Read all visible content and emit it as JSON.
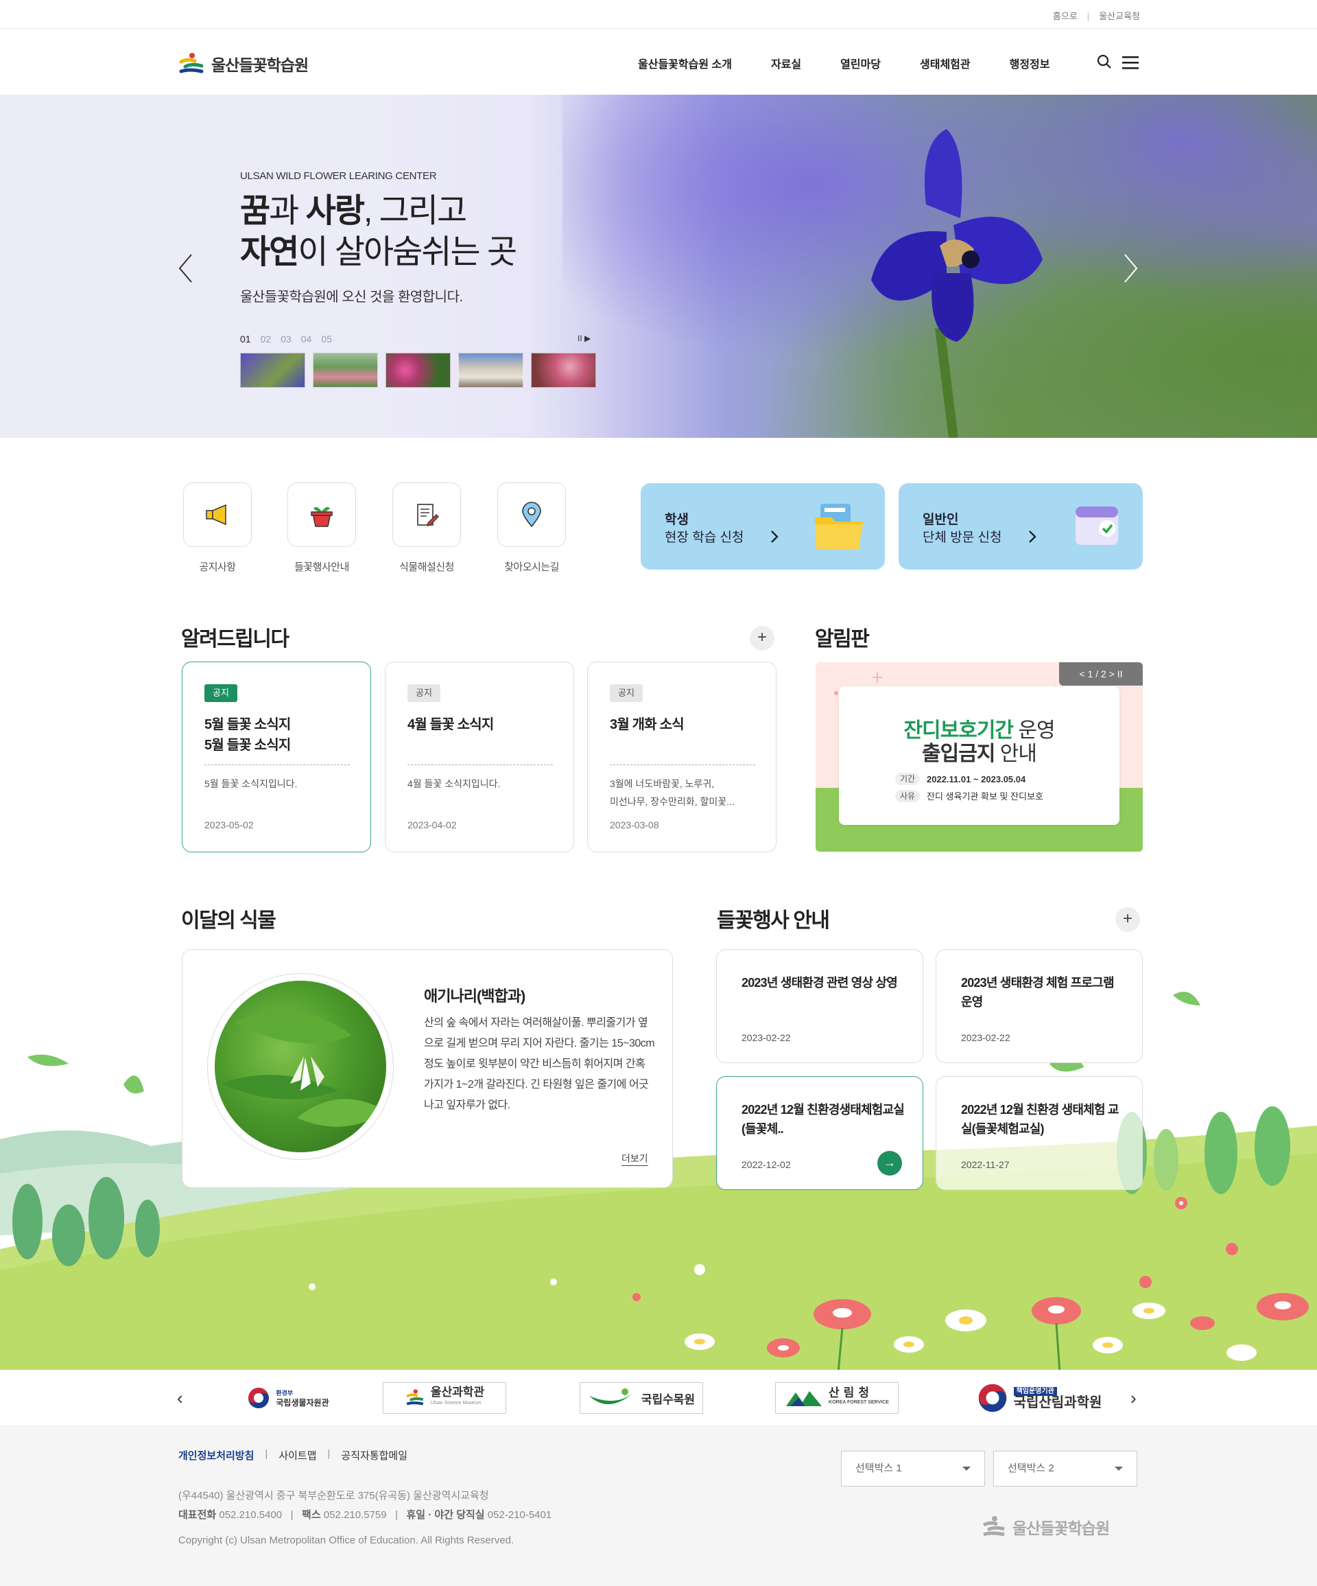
{
  "utility": {
    "home": "홈으로",
    "office": "울산교육청"
  },
  "header": {
    "logo": "울산들꽃학습원",
    "nav": [
      "울산들꽃학습원 소개",
      "자료실",
      "열린마당",
      "생태체험관",
      "행정정보"
    ]
  },
  "hero": {
    "subtitle": "ULSAN WILD FLOWER LEARING CENTER",
    "title_line1_bold1": "꿈",
    "title_line1_part1": "과 ",
    "title_line1_bold2": "사랑",
    "title_line1_part2": ", 그리고",
    "title_line2_bold": "자연",
    "title_line2_rest": "이 살아숨쉬는 곳",
    "desc": "울산들꽃학습원에 오신 것을 환영합니다.",
    "pages": [
      "01",
      "02",
      "03",
      "04",
      "05"
    ],
    "active_page": "01",
    "controls": "II ▶"
  },
  "quick": [
    {
      "label": "공지사항",
      "icon": "megaphone-icon"
    },
    {
      "label": "들꽃행사안내",
      "icon": "flower-pot-icon"
    },
    {
      "label": "식물해설신청",
      "icon": "document-edit-icon"
    },
    {
      "label": "찾아오시는길",
      "icon": "location-pin-icon"
    }
  ],
  "apply": [
    {
      "line1": "학생",
      "line2": "현장 학습 신청",
      "icon": "folder-icon"
    },
    {
      "line1": "일반인",
      "line2": "단체 방문 신청",
      "icon": "calendar-check-icon"
    }
  ],
  "notice": {
    "title": "알려드립니다",
    "plus": "+",
    "cards": [
      {
        "tag": "공지",
        "title": "5월 들꽃 소식지\n5월 들꽃 소식지",
        "desc": "5월 들꽃 소식지입니다.",
        "date": "2023-05-02"
      },
      {
        "tag": "공지",
        "title": "4월 들꽃 소식지",
        "desc": "4월 들꽃 소식지입니다.",
        "date": "2023-04-02"
      },
      {
        "tag": "공지",
        "title": "3월 개화 소식",
        "desc": "3월에 너도바람꽃, 노루귀,\n미선나무, 장수만리화, 할미꽃...",
        "date": "2023-03-08"
      }
    ]
  },
  "board": {
    "title": "알림판",
    "pager": "< 1 / 2 >  II",
    "b1_green": "잔디보호기간",
    "b1_rest": " 운영",
    "b2_bold": "출입금지",
    "b2_rest": " 안내",
    "k1": "기간",
    "v1": "2022.11.01 ~ 2023.05.04",
    "k2": "사유",
    "v2": "잔디 생육기관 확보 및 잔디보호"
  },
  "plant": {
    "section": "이달의 식물",
    "name": "애기나리(백합과)",
    "desc": "산의 숲 속에서 자라는 여러해살이풀. 뿌리줄기가 옆으로 길게 벋으며 무리 지어 자란다. 줄기는 15~30cm 정도 높이로 윗부분이 약간 비스듬히 휘어지며 간혹 가지가 1~2개 갈라진다. 긴 타원형 잎은 줄기에 어긋나고 잎자루가 없다.",
    "more": "더보기"
  },
  "events": {
    "title": "들꽃행사 안내",
    "plus": "+",
    "items": [
      {
        "title": "2023년 생태환경 관련 영상 상영",
        "date": "2023-02-22"
      },
      {
        "title": "2023년 생태환경 체험 프로그램 운영",
        "date": "2023-02-22"
      },
      {
        "title": "2022년 12월 친환경생태체험교실(들꽃체..",
        "date": "2022-12-02",
        "go": "→"
      },
      {
        "title": "2022년 12월 친환경 생태체험 교실(들꽃체험교실)",
        "date": "2022-11-27"
      }
    ]
  },
  "partners": {
    "items": [
      "국립생물자원관",
      "울산과학관",
      "국립수목원",
      "산림청",
      "국립산림과학원"
    ],
    "sub1": "환경부",
    "sub2": "Ulsan Science Museum",
    "sub3": "KOREA FOREST SERVICE",
    "sub4": "책임운영기관",
    "prev": "‹",
    "next": "›"
  },
  "footer": {
    "links": [
      "개인정보처리방침",
      "사이트맵",
      "공직자통합메일"
    ],
    "address": "(우44540) 울산광역시 중구 북부순환도로 375(유곡동) 울산광역시교육청",
    "tel_label": "대표전화",
    "tel": "052.210.5400",
    "fax_label": "팩스",
    "fax": "052.210.5759",
    "night_label": "휴일 · 야간 당직실",
    "night": "052-210-5401",
    "copyright": "Copyright (c) Ulsan Metropolitan Office of Education. All Rights Reserved.",
    "select1": "선택박스 1",
    "select2": "선택박스 2",
    "logo": "울산들꽃학습원"
  }
}
